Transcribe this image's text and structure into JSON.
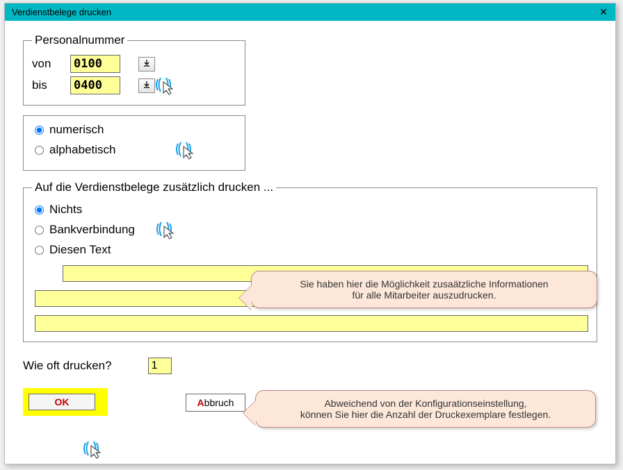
{
  "window": {
    "title": "Verdienstbelege drucken"
  },
  "personalnummer": {
    "legend": "Personalnummer",
    "von_label": "von",
    "bis_label": "bis",
    "von_value": "0100",
    "bis_value": "0400"
  },
  "sortierung": {
    "numerisch": "numerisch",
    "alphabetisch": "alphabetisch",
    "selected": "numerisch"
  },
  "zusatz": {
    "legend": "Auf die Verdienstbelege zusätzlich drucken ...",
    "nichts": "Nichts",
    "bankverbindung": "Bankverbindung",
    "diesen_text": "Diesen Text",
    "selected": "nichts",
    "text_lines": [
      "",
      "",
      ""
    ]
  },
  "howoft": {
    "label": "Wie oft drucken?",
    "value": "1"
  },
  "buttons": {
    "ok": "OK",
    "abbruch": "Abbruch"
  },
  "callouts": {
    "c1_line1": "Sie haben hier die Möglichkeit zusaätzliche Informationen",
    "c1_line2": "für alle Mitarbeiter auszudrucken.",
    "c2_line1": "Abweichend von der Konfigurationseinstellung,",
    "c2_line2": "können Sie hier die Anzahl der Druckexemplare festlegen."
  }
}
